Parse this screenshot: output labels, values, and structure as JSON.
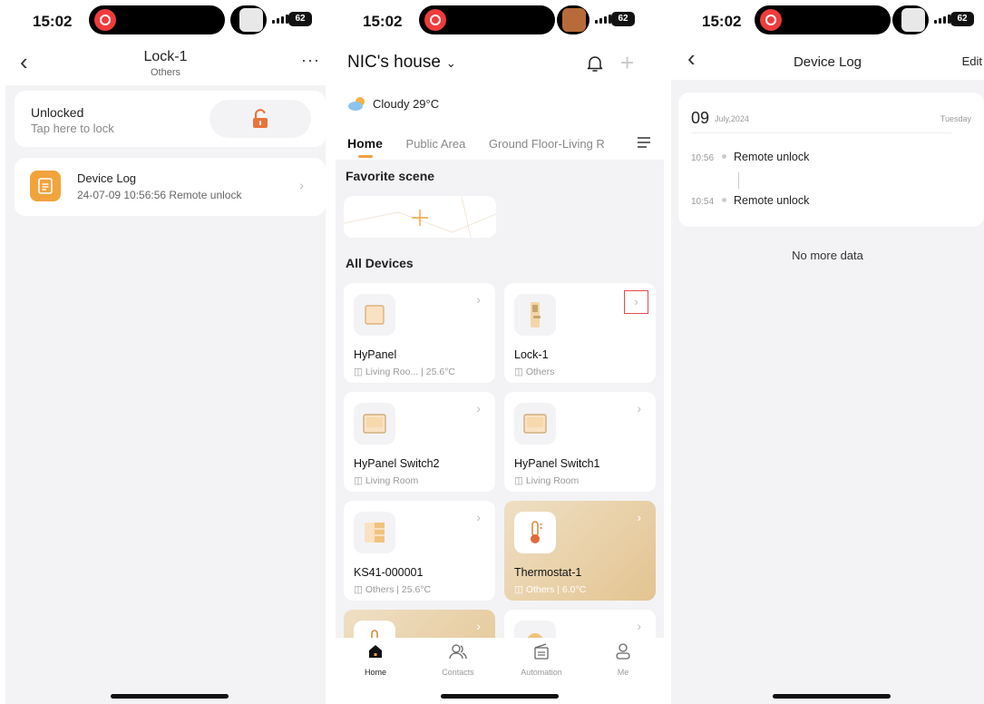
{
  "status": {
    "left_time": "15:02",
    "middle_time": "15:02",
    "right_time": "15:02",
    "battery": "62"
  },
  "lock_screen": {
    "title": "Lock-1",
    "subtitle": "Others",
    "more_label": "···",
    "lock_state": "Unlocked",
    "lock_hint": "Tap here to lock",
    "log_title": "Device Log",
    "log_last": "24-07-09 10:56:56 Remote unlock"
  },
  "home_screen": {
    "house_name": "NIC's house",
    "weather": "Cloudy 29°C",
    "tabs": [
      "Home",
      "Public Area",
      "Ground Floor-Living R"
    ],
    "favorite_scene": "Favorite scene",
    "all_devices": "All Devices",
    "devices": [
      {
        "name": "HyPanel",
        "meta": "Living Roo... | 25.6°C",
        "icon": "panel-icon"
      },
      {
        "name": "Lock-1",
        "meta": "Others",
        "icon": "door-lock-icon"
      },
      {
        "name": "HyPanel Switch2",
        "meta": "Living Room",
        "icon": "switch-icon"
      },
      {
        "name": "HyPanel Switch1",
        "meta": "Living Room",
        "icon": "switch-icon"
      },
      {
        "name": "KS41-000001",
        "meta": "Others | 25.6°C",
        "icon": "ks41-icon"
      },
      {
        "name": "Thermostat-1",
        "meta": "Others | 6.0°C",
        "icon": "thermostat-icon"
      }
    ],
    "tabbar": [
      "Home",
      "Contacts",
      "Automation",
      "Me"
    ]
  },
  "log_screen": {
    "title": "Device Log",
    "edit": "Edit",
    "day": "09",
    "month": "July,2024",
    "weekday": "Tuesday",
    "entries": [
      {
        "time": "10:56",
        "text": "Remote unlock"
      },
      {
        "time": "10:54",
        "text": "Remote unlock"
      }
    ],
    "no_more": "No more data"
  },
  "colors": {
    "accent": "#f1a43c",
    "lock_icon": "#e8743c",
    "highlight_box": "#e24b4b",
    "background": "#f3f3f5"
  }
}
